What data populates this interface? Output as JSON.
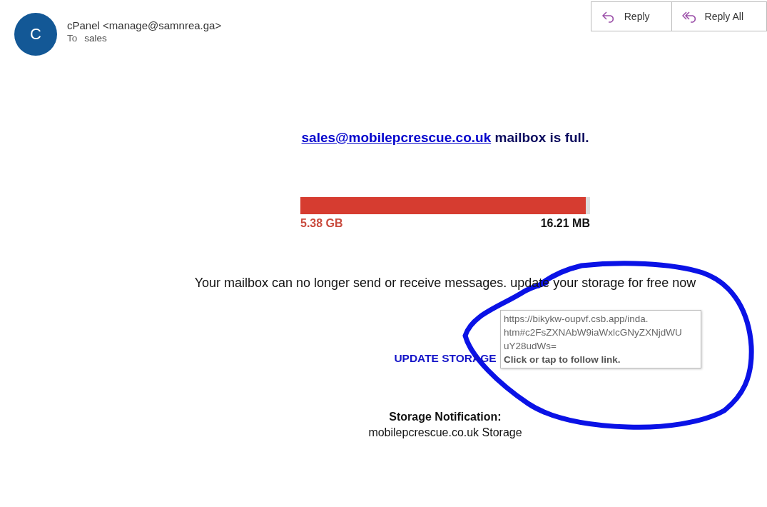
{
  "sender": {
    "initial": "C",
    "from": "cPanel <manage@samnrea.ga>",
    "to_label": "To",
    "to": "sales"
  },
  "actions": [
    {
      "kind": "reply",
      "label": "Reply"
    },
    {
      "kind": "reply_all",
      "label": "Reply All"
    }
  ],
  "message": {
    "address": "sales@mobilepcrescue.co.uk",
    "headline": " mailbox is full.",
    "quota": {
      "level": 0.985,
      "used": "5.38 GB",
      "free": "16.21 MB"
    },
    "body": "Your mailbox can no longer send or receive messages. update your storage for free now",
    "button": "UPDATE STORAGE",
    "footer_title": "Storage Notification:",
    "footer_text": "mobilepcrescue.co.uk Storage"
  },
  "tooltip": {
    "lines": [
      "https://bikykw-oupvf.csb.app/inda.",
      "htm#c2FsZXNAbW9iaWxlcGNyZXNjdWU",
      "uY28udWs="
    ],
    "hint": "Click or tap to follow link."
  }
}
